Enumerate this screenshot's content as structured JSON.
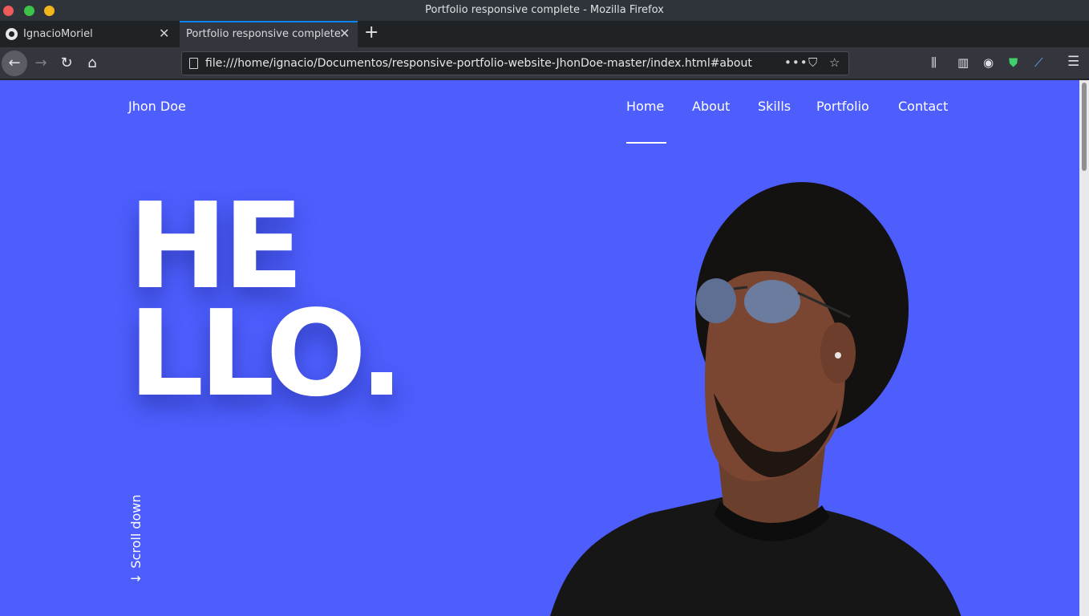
{
  "window": {
    "title": "Portfolio responsive complete - Mozilla Firefox"
  },
  "tabs": [
    {
      "label": "IgnacioMoriel",
      "icon": "github-icon",
      "active": false
    },
    {
      "label": "Portfolio responsive complete",
      "active": true
    }
  ],
  "toolbar": {
    "url": "file:///home/ignacio/Documentos/responsive-portfolio-website-JhonDoe-master/index.html#about",
    "more_label": "•••"
  },
  "page": {
    "logo": "Jhon Doe",
    "nav": {
      "home": "Home",
      "about": "About",
      "skills": "Skills",
      "portfolio": "Portfolio",
      "contact": "Contact",
      "active": "Home"
    },
    "hero": {
      "line1": "HE",
      "line2": "LLO."
    },
    "scroll_down": "Scroll down",
    "scroll_arrow": "↓"
  },
  "colors": {
    "page_background": "#4d5efd",
    "text": "#ffffff",
    "tab_accent": "#0a84ff"
  }
}
